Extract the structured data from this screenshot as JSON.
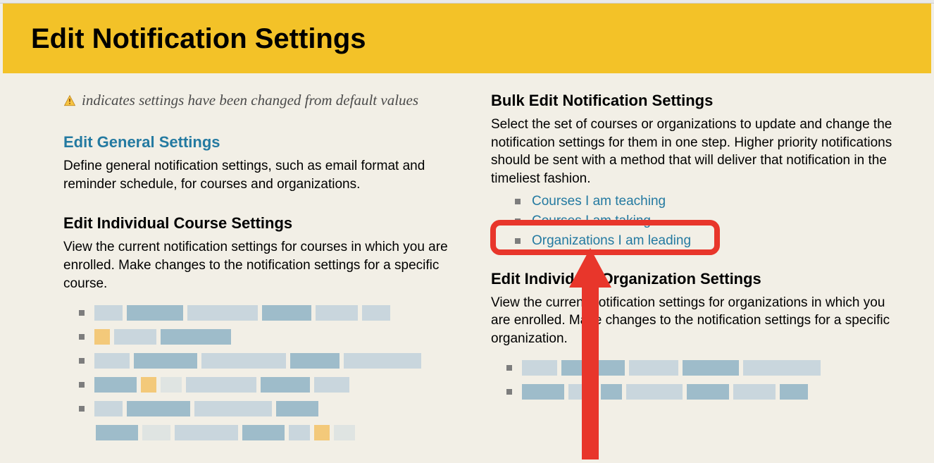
{
  "header": {
    "title": "Edit Notification Settings"
  },
  "legend": {
    "text": "indicates settings have been changed from default values"
  },
  "sections": {
    "general": {
      "title": "Edit General Settings",
      "desc": "Define general notification settings, such as email format and reminder schedule, for courses and organizations."
    },
    "individual_course": {
      "title": "Edit Individual Course Settings",
      "desc": "View the current notification settings for courses in which you are enrolled. Make changes to the notification settings for a specific course."
    },
    "bulk": {
      "title": "Bulk Edit Notification Settings",
      "desc": "Select the set of courses or organizations to update and change the notification settings for them in one step. Higher priority notifications should be sent with a method that will deliver that notification in the timeliest fashion.",
      "options": {
        "teaching": "Courses I am teaching",
        "taking": "Courses I am taking",
        "leading": "Organizations I am leading"
      }
    },
    "individual_org": {
      "title": "Edit Individual Organization Settings",
      "desc": "View the current notification settings for organizations in which you are enrolled. Make changes to the notification settings for a specific organization."
    }
  }
}
